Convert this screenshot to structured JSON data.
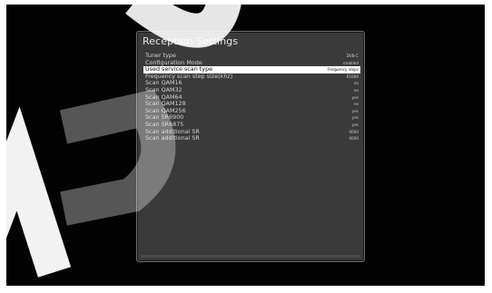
{
  "panel": {
    "title": "Reception Settings",
    "rows": [
      {
        "label": "Tuner type",
        "value": "DVB-C",
        "selected": false
      },
      {
        "label": "Configuration Mode",
        "value": "enabled",
        "selected": false
      },
      {
        "label": "Used service scan type",
        "value": "Frequency steps",
        "selected": true
      },
      {
        "label": "Frequency scan step size(khz)",
        "value": "01000",
        "selected": false
      },
      {
        "label": "Scan QAM16",
        "value": "no",
        "selected": false
      },
      {
        "label": "Scan QAM32",
        "value": "no",
        "selected": false
      },
      {
        "label": "Scan QAM64",
        "value": "yes",
        "selected": false
      },
      {
        "label": "Scan QAM128",
        "value": "no",
        "selected": false
      },
      {
        "label": "Scan QAM256",
        "value": "yes",
        "selected": false
      },
      {
        "label": "Scan SR6900",
        "value": "yes",
        "selected": false
      },
      {
        "label": "Scan SR6875",
        "value": "yes",
        "selected": false
      },
      {
        "label": "Scan additional SR",
        "value": "0000",
        "selected": false
      },
      {
        "label": "Scan additional SR",
        "value": "0000",
        "selected": false
      }
    ]
  },
  "watermark": {
    "text": "ADO",
    "color": "#ffffff"
  }
}
